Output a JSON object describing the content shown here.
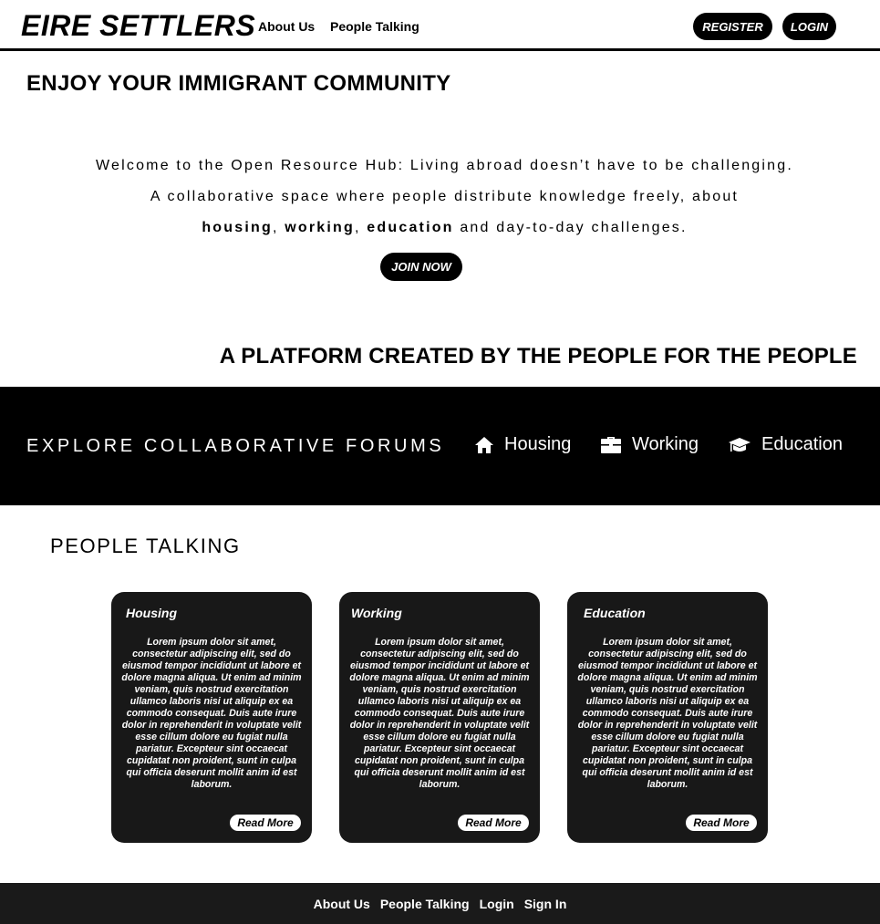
{
  "header": {
    "logo": "EIRE SETTLERS",
    "nav": {
      "about": "About Us",
      "people": "People Talking"
    },
    "register_label": "REGISTER",
    "login_label": "LOGIN"
  },
  "hero": {
    "title": "ENJOY YOUR IMMIGRANT COMMUNITY",
    "line1": "Welcome to the Open Resource Hub: Living abroad doesn’t have to be challenging.",
    "line2": "A collaborative space where people distribute knowledge freely, about",
    "line3": {
      "housing": "housing",
      "sep1": ", ",
      "working": "working",
      "sep2": ", ",
      "education": "education",
      "rest": " and day-to-day challenges."
    },
    "join_label": "JOIN NOW"
  },
  "platform_title": "A PLATFORM CREATED BY THE PEOPLE FOR THE PEOPLE",
  "forums": {
    "title": "EXPLORE COLLABORATIVE FORUMS",
    "housing": "Housing",
    "working": "Working",
    "education": "Education",
    "icons": {
      "housing": "home-icon",
      "working": "briefcase-icon",
      "education": "graduation-cap-icon"
    }
  },
  "people": {
    "title": "PEOPLE TALKING",
    "cards": [
      {
        "title": "Housing",
        "body": "Lorem ipsum dolor sit amet, consectetur adipiscing elit, sed do eiusmod tempor incididunt ut labore et dolore magna aliqua. Ut enim ad minim veniam, quis nostrud exercitation ullamco laboris nisi ut aliquip ex ea commodo consequat. Duis aute irure dolor in reprehenderit in voluptate velit esse cillum dolore eu fugiat nulla pariatur. Excepteur sint occaecat cupidatat non proident, sunt in culpa qui officia deserunt mollit anim id est laborum.",
        "read_more": "Read More"
      },
      {
        "title": "Working",
        "body": "Lorem ipsum dolor sit amet, consectetur adipiscing elit, sed do eiusmod tempor incididunt ut labore et dolore magna aliqua. Ut enim ad minim veniam, quis nostrud exercitation ullamco laboris nisi ut aliquip ex ea commodo consequat. Duis aute irure dolor in reprehenderit in voluptate velit esse cillum dolore eu fugiat nulla pariatur. Excepteur sint occaecat cupidatat non proident, sunt in culpa qui officia deserunt mollit anim id est laborum.",
        "read_more": "Read More"
      },
      {
        "title": "Education",
        "body": "Lorem ipsum dolor sit amet, consectetur adipiscing elit, sed do eiusmod tempor incididunt ut labore et dolore magna aliqua. Ut enim ad minim veniam, quis nostrud exercitation ullamco laboris nisi ut aliquip ex ea commodo consequat. Duis aute irure dolor in reprehenderit in voluptate velit esse cillum dolore eu fugiat nulla pariatur. Excepteur sint occaecat cupidatat non proident, sunt in culpa qui officia deserunt mollit anim id est laborum.",
        "read_more": "Read More"
      }
    ]
  },
  "footer": {
    "about": "About Us",
    "people": "People Talking",
    "login": "Login",
    "signin": "Sign In"
  }
}
